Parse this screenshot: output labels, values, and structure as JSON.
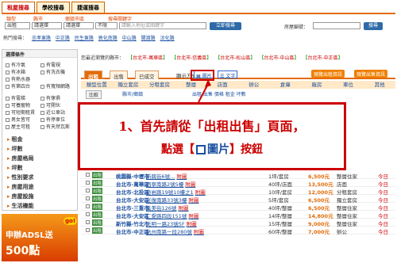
{
  "tabs": [
    {
      "label": "租屋搜尋"
    },
    {
      "label": "學校搜尋"
    },
    {
      "label": "捷運搜尋"
    }
  ],
  "search": {
    "labels": [
      "類型",
      "縣市",
      "鄉鎮市區",
      "搜尋關鍵字"
    ],
    "type_value": "出租",
    "city_value": "請選擇",
    "district_value": "請選擇",
    "kw_value": "不限",
    "kw_placeholder": "請輸入地址或關鍵字",
    "submit": "立即搜尋",
    "right_label": "房屋編號：",
    "right_hint": "搜尋"
  },
  "hot": {
    "label": "熱門搜尋：",
    "items": [
      "忠孝東路",
      "中正路",
      "民生東路",
      "敦化南路",
      "中山路",
      "關渡路",
      "汶化路"
    ]
  },
  "side": {
    "header": "選擇條件",
    "options": [
      "有冷氣",
      "有電視",
      "有冰箱",
      "有洗衣機",
      "有熱水器",
      "有第四台",
      "有寬頻網路",
      "有電梯",
      "有傢俱",
      "可養寵物",
      "可開伙",
      "可短期租賃",
      "近公車站",
      "男女皆可",
      "有停車位",
      "屋主可租",
      "有天然瓦斯"
    ],
    "cats": [
      "租金",
      "坪數",
      "房屋格局",
      "坪數",
      "性別要求",
      "房屋用途",
      "房屋設施",
      "生活機能"
    ],
    "cat_more": "請選擇"
  },
  "ad": {
    "line1": "申辦ADSL送",
    "line2": "500點",
    "badge": "go!"
  },
  "cityline": {
    "prefix": "您最近瀏覽的縣市：",
    "cities": [
      "台北市-萬華區",
      "台北市-信義區",
      "台北市-松山區",
      "台北市-中山區",
      "台北市-中正區"
    ]
  },
  "toolbar": {
    "tabs": [
      "出租",
      "出售",
      "已成交"
    ],
    "view_label": "顯示方式：",
    "btn_pic": "圖片",
    "btn_text": "文字",
    "btn_orange1": "預覽出租資訊",
    "btn_orange2": "預覽出售資訊"
  },
  "thead": [
    "類型位置",
    "獨立套房",
    "分租套房",
    "整層",
    "店面",
    "辦公",
    "倉庫",
    "廠房",
    "車位",
    "其他"
  ],
  "row2": {
    "compare": "比較",
    "label": "縣市/鄉鎮",
    "hint": "出租 出售 價格 租金 坪數"
  },
  "rows": [
    {
      "tag": "出租",
      "loc": "桃園縣-中壢市",
      "addr": "新興街6號...",
      "area": "1坪/套房",
      "price": "6,500元",
      "type": "整層住家",
      "date": "今日"
    },
    {
      "tag": "出租",
      "loc": "台北市-萬華區",
      "addr": "西寧南路2號5樓",
      "area": "40坪/店面",
      "price": "13,500元",
      "type": "店面",
      "date": "今日"
    },
    {
      "tag": "出租",
      "loc": "台北市-北投區",
      "addr": "奇岩路19號10樓之1",
      "area": "10坪/套房",
      "price": "12,000元",
      "type": "分租套房",
      "date": "今日"
    },
    {
      "tag": "出租",
      "loc": "台北市-大安區",
      "addr": "光復南路33號3樓",
      "area": "5坪/套房",
      "price": "6,500元",
      "type": "獨立套房",
      "date": "今日"
    },
    {
      "tag": "出租",
      "loc": "台北市-三重市",
      "addr": "集美街126號",
      "area": "40坪/整層",
      "price": "6,500元",
      "type": "整層住家",
      "date": "今日"
    },
    {
      "tag": "出租",
      "loc": "台北市-大安區",
      "addr": "仁愛路四段151號",
      "area": "14坪/整層",
      "price": "14,800元",
      "type": "整層住家",
      "date": "今日"
    },
    {
      "tag": "出租",
      "loc": "新竹縣-竹北市",
      "addr": "光明一路23號5F",
      "area": "15坪/整層",
      "price": "9,000元",
      "type": "整層住家",
      "date": "今日"
    },
    {
      "tag": "出租",
      "loc": "台北市-中正區",
      "addr": "杭州南路一段280號",
      "area": "60坪/整層",
      "price": "7,000元",
      "type": "辦公",
      "date": "今日"
    }
  ],
  "row_suffix": "附圖",
  "callout": {
    "line1": "1、首先請從「出租出售」頁面，",
    "line2_a": "點選【",
    "line2_b": "圖片",
    "line2_c": "】按鈕"
  }
}
